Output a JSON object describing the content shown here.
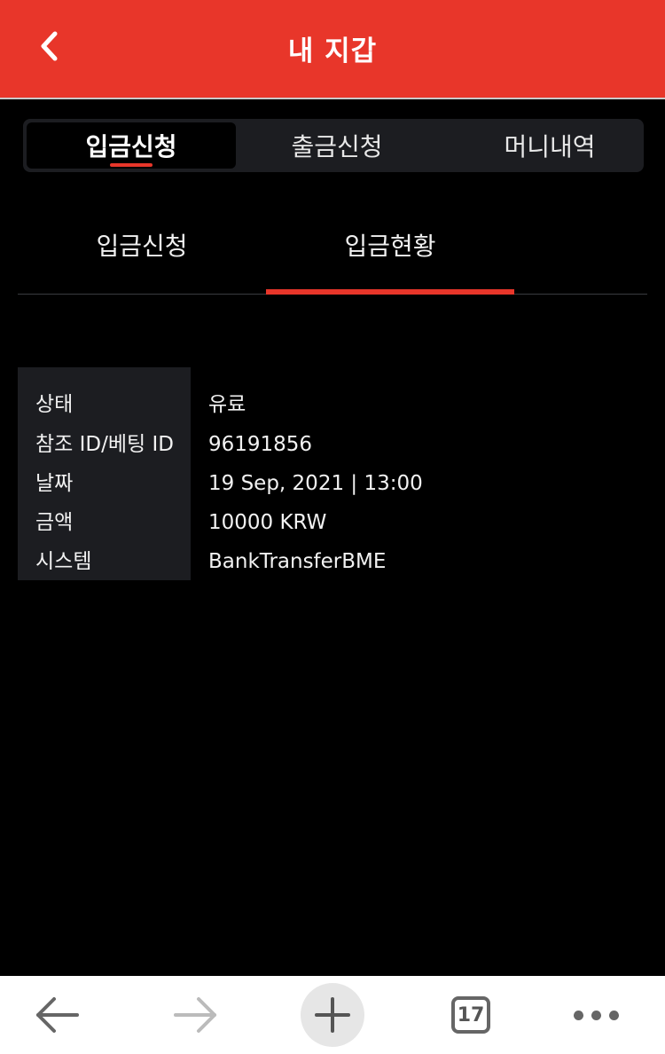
{
  "header": {
    "title": "내 지갑",
    "back_icon": "chevron-left-icon",
    "color": "#e8362a"
  },
  "segment_tabs": [
    {
      "label": "입금신청",
      "active": true
    },
    {
      "label": "출금신청",
      "active": false
    },
    {
      "label": "머니내역",
      "active": false
    }
  ],
  "sub_tabs": [
    {
      "label": "입금신청",
      "active": false
    },
    {
      "label": "입금현황",
      "active": true
    }
  ],
  "details": {
    "rows": [
      {
        "label": "상태",
        "value": "유료"
      },
      {
        "label": "참조 ID/베팅 ID",
        "value": "96191856"
      },
      {
        "label": "날짜",
        "value": "19 Sep, 2021 | 13:00"
      },
      {
        "label": "금액",
        "value": "10000 KRW"
      },
      {
        "label": "시스템",
        "value": "BankTransferBME"
      }
    ]
  },
  "bottom_bar": {
    "back_icon": "arrow-left-icon",
    "forward_icon": "arrow-right-icon",
    "new_tab_icon": "plus-icon",
    "tabs_count": "17",
    "more_icon": "more-dots-icon"
  },
  "colors": {
    "accent": "#e8362a",
    "background": "#000000",
    "panel": "#1c1d21"
  }
}
